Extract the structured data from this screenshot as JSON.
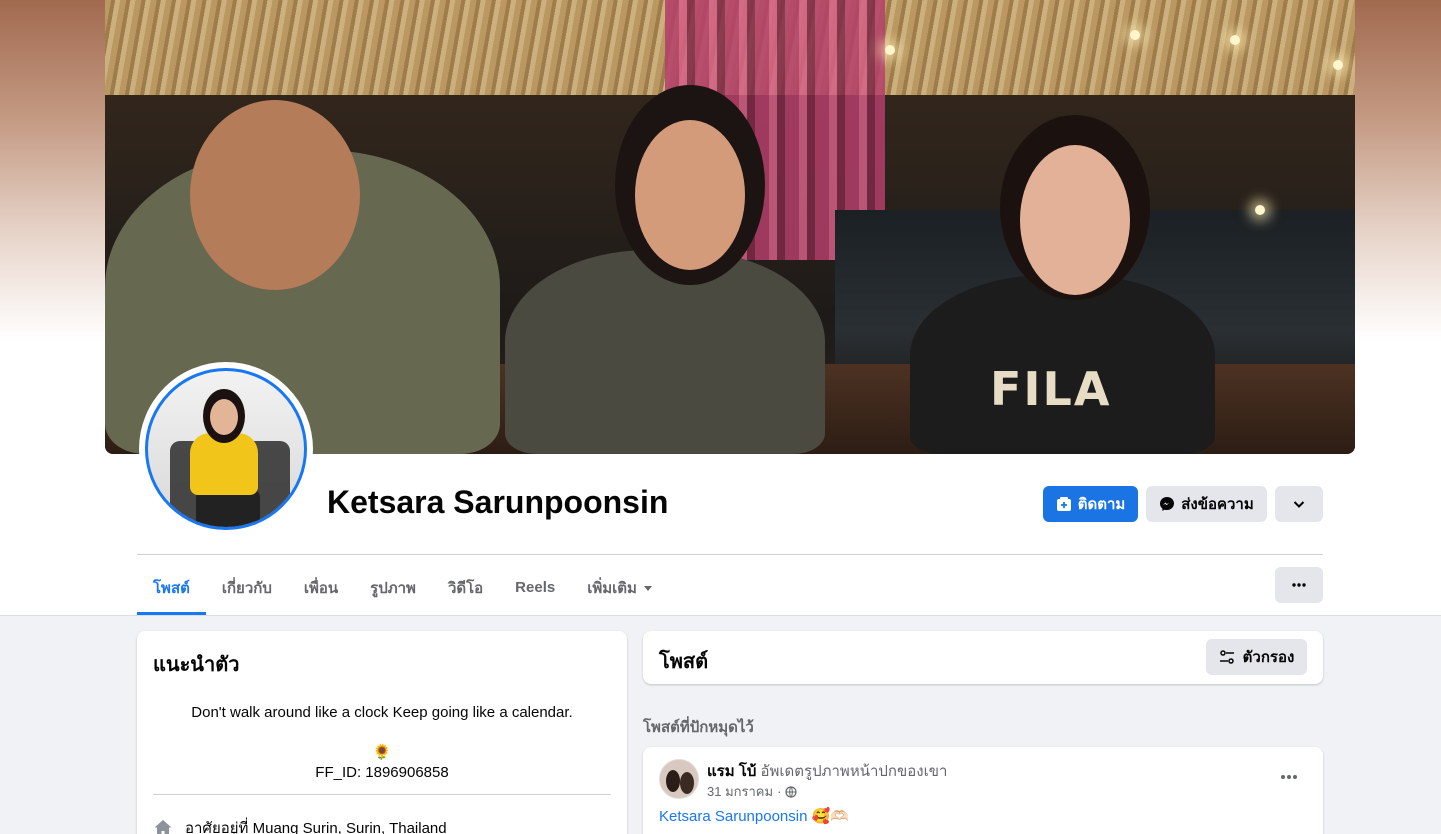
{
  "profile": {
    "name": "Ketsara Sarunpoonsin",
    "cover_text": "FILA"
  },
  "actions": {
    "follow_label": "ติดตาม",
    "message_label": "ส่งข้อความ"
  },
  "tabs": [
    {
      "label": "โพสต์",
      "active": true
    },
    {
      "label": "เกี่ยวกับ"
    },
    {
      "label": "เพื่อน"
    },
    {
      "label": "รูปภาพ"
    },
    {
      "label": "วิดีโอ"
    },
    {
      "label": "Reels"
    },
    {
      "label": "เพิ่มเติม"
    }
  ],
  "intro": {
    "title": "แนะนำตัว",
    "bio_line1": "Don't walk around like a clock Keep going like a calendar.",
    "bio_emoji": "🌻",
    "bio_line2": "FF_ID: 1896906858",
    "lives_prefix": "อาศัยอยู่ที่",
    "lives_place": "Muang Surin, Surin, Thailand"
  },
  "posts": {
    "title": "โพสต์",
    "filter_label": "ตัวกรอง",
    "pinned_label": "โพสต์ที่ปักหมุดไว้"
  },
  "post": {
    "author": "แรม โบ้",
    "action": "อัพเดตรูปภาพหน้าปกของเขา",
    "date": "31 มกราคม",
    "separator": "·",
    "text_link": "Ketsara Sarunpoonsin",
    "text_emoji": "🥰🫶🏻"
  },
  "colors": {
    "accent": "#1877f2",
    "primary_button": "#1b74e4",
    "secondary_button": "#e4e6eb",
    "page_bg": "#f0f2f5"
  }
}
